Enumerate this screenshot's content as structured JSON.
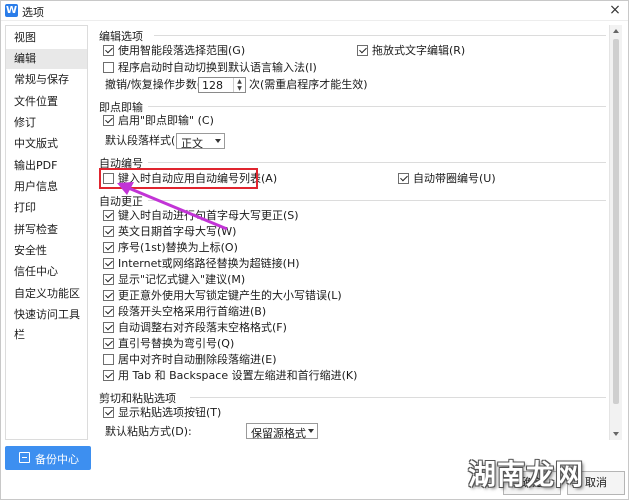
{
  "window": {
    "title": "选项",
    "app_icon_letter": "W"
  },
  "sidebar": {
    "items": [
      {
        "label": "视图"
      },
      {
        "label": "编辑",
        "active": true
      },
      {
        "label": "常规与保存"
      },
      {
        "label": "文件位置"
      },
      {
        "label": "修订"
      },
      {
        "label": "中文版式"
      },
      {
        "label": "输出PDF"
      },
      {
        "label": "用户信息"
      },
      {
        "label": "打印"
      },
      {
        "label": "拼写检查"
      },
      {
        "label": "安全性"
      },
      {
        "label": "信任中心"
      },
      {
        "label": "自定义功能区"
      },
      {
        "label": "快速访问工具栏"
      }
    ],
    "backup_label": "备份中心"
  },
  "editing": {
    "title": "编辑选项",
    "smart_para": {
      "label": "使用智能段落选择范围(G)",
      "checked": true
    },
    "drag_drop": {
      "label": "拖放式文字编辑(R)",
      "checked": true
    },
    "auto_ime": {
      "label": "程序启动时自动切换到默认语言输入法(I)",
      "checked": false
    },
    "undo_label": "撤销/恢复操作步数(N):",
    "undo_value": "128",
    "undo_hint": "次(需重启程序才能生效)"
  },
  "click_type": {
    "title": "即点即输",
    "enable": {
      "label": "启用\"即点即输\" (C)",
      "checked": true
    },
    "default_style_label": "默认段落样式(P):",
    "default_style_value": "正文"
  },
  "auto_number": {
    "title": "自动编号",
    "auto_list": {
      "label": "键入时自动应用自动编号列表(A)",
      "checked": false
    },
    "circled": {
      "label": "自动带圈编号(U)",
      "checked": true
    }
  },
  "autocorrect": {
    "title": "自动更正",
    "items": [
      {
        "label": "键入时自动进行句首字母大写更正(S)",
        "checked": true
      },
      {
        "label": "英文日期首字母大写(W)",
        "checked": true
      },
      {
        "label": "序号(1st)替换为上标(O)",
        "checked": true
      },
      {
        "label": "Internet或网络路径替换为超链接(H)",
        "checked": true
      },
      {
        "label": "显示\"记忆式键入\"建议(M)",
        "checked": true
      },
      {
        "label": "更正意外使用大写锁定键产生的大小写错误(L)",
        "checked": true
      },
      {
        "label": "段落开头空格采用行首缩进(B)",
        "checked": true
      },
      {
        "label": "自动调整右对齐段落末空格格式(F)",
        "checked": true
      },
      {
        "label": "直引号替换为弯引号(Q)",
        "checked": true
      },
      {
        "label": "居中对齐时自动删除段落缩进(E)",
        "checked": false
      },
      {
        "label": "用 Tab 和 Backspace 设置左缩进和首行缩进(K)",
        "checked": true
      }
    ]
  },
  "paste": {
    "title": "剪切和粘贴选项",
    "show_btn": {
      "label": "显示粘贴选项按钮(T)",
      "checked": true
    },
    "default_label": "默认粘贴方式(D):",
    "default_value": "保留源格式"
  },
  "footer": {
    "ok_label": "确定",
    "cancel_label": "取消"
  },
  "watermark": "湖南龙网",
  "colors": {
    "accent": "#3d8ff0",
    "highlight": "#e0252f",
    "arrow": "#c234d6"
  }
}
